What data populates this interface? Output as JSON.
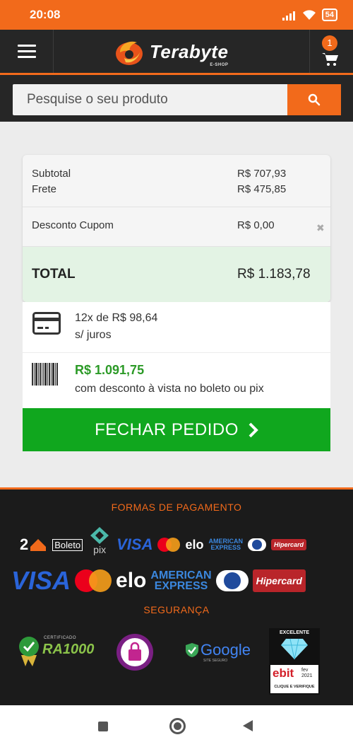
{
  "status_bar": {
    "time": "20:08",
    "battery": "54"
  },
  "header": {
    "brand": "Terabyte",
    "brand_sub": "E-SHOP",
    "cart_count": "1"
  },
  "search": {
    "placeholder": "Pesquise o seu produto"
  },
  "summary": {
    "subtotal_label": "Subtotal",
    "subtotal_value": "R$ 707,93",
    "freight_label": "Frete",
    "freight_value": "R$ 475,85",
    "coupon_label": "Desconto Cupom",
    "coupon_value": "R$ 0,00",
    "total_label": "TOTAL",
    "total_value": "R$ 1.183,78"
  },
  "payment": {
    "installments": "12x de R$ 98,64",
    "installments_note": "s/ juros",
    "cash_price": "R$ 1.091,75",
    "cash_note": "com desconto à vista no boleto ou pix"
  },
  "checkout": {
    "label": "FECHAR PEDIDO"
  },
  "footer": {
    "payment_title": "FORMAS DE PAGAMENTO",
    "security_title": "SEGURANÇA",
    "logos": {
      "two_label": "2",
      "boleto": "Boleto",
      "pix": "pix",
      "visa": "VISA",
      "elo": "elo",
      "amex_line1": "AMERICAN",
      "amex_line2": "EXPRESS",
      "hipercard": "Hipercard",
      "ra_small": "CERTIFICADO",
      "ra_big": "RA1000",
      "google": "Google",
      "google_sub": "SITE SEGURO",
      "ebit_top": "EXCELENTE",
      "ebit_brand": "ebit",
      "ebit_date": "fev 2021",
      "ebit_cta": "CLIQUE E VERIFIQUE"
    }
  },
  "colors": {
    "accent": "#f26a1b",
    "dark": "#262626",
    "green": "#10a71e",
    "price_green": "#2c9a27",
    "total_bg": "#e3f3e4"
  }
}
